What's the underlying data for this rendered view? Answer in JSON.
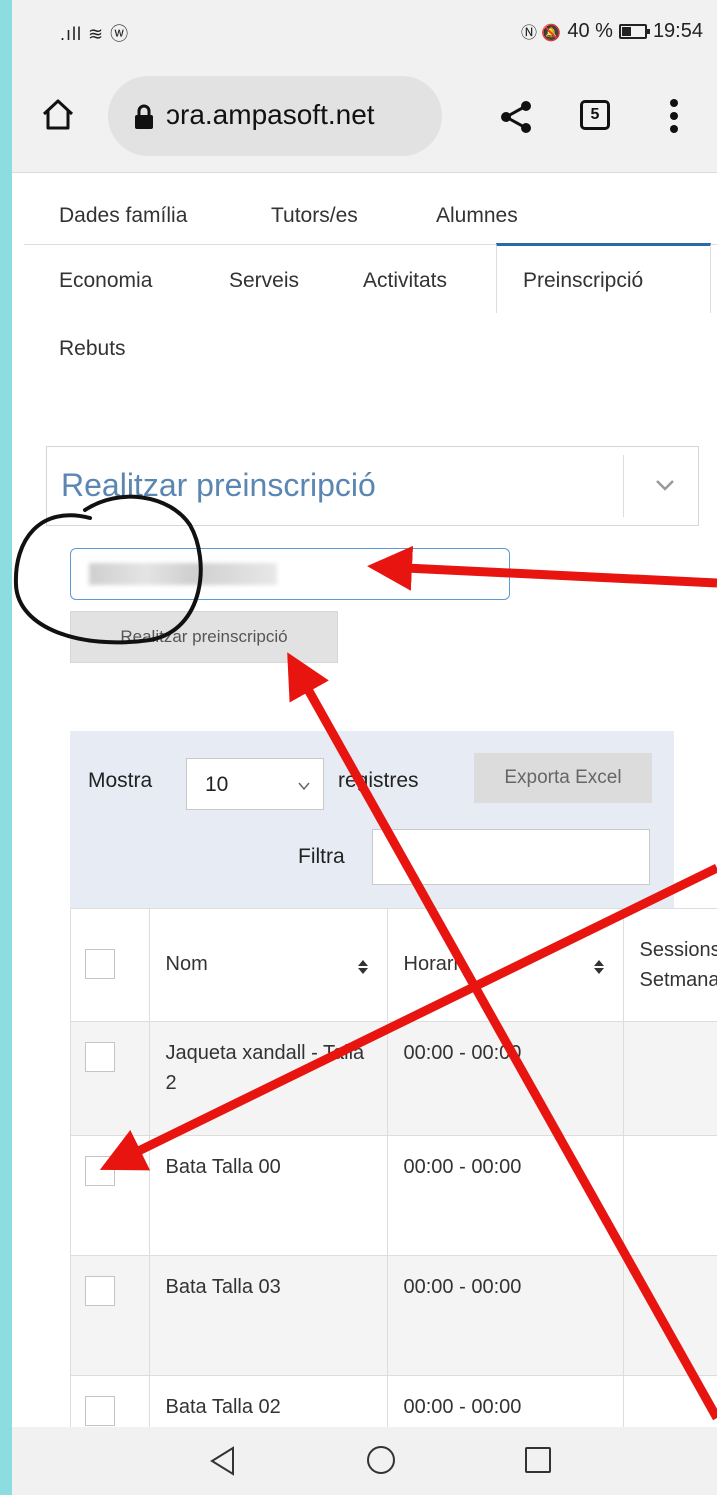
{
  "status_bar": {
    "left_icons": ".ıll ≋ ⓦ",
    "right_icons": "Ⓝ 🔕",
    "battery": "40 %",
    "time": "19:54"
  },
  "browser": {
    "url": "ɔra.ampasoft.net",
    "tab_count": "5"
  },
  "nav": {
    "row1": [
      "Dades família",
      "Tutors/es",
      "Alumnes"
    ],
    "row2": [
      "Economia",
      "Serveis",
      "Activitats",
      "Preinscripció"
    ],
    "row3": [
      "Rebuts"
    ],
    "active": "Preinscripció"
  },
  "panel": {
    "title": "Realitzar preinscripció",
    "button_label": "Realitzar preinscripció"
  },
  "controls": {
    "show_label": "Mostra",
    "length_value": "10",
    "records_label": "registres",
    "export_label": "Exporta Excel",
    "filter_label": "Filtra",
    "filter_value": ""
  },
  "table": {
    "headers": [
      "Nom",
      "Horari",
      "Sessions",
      "Setmanals"
    ],
    "rows": [
      {
        "nom": "Jaqueta xandall - Talla 2",
        "horari": "00:00 - 00:00"
      },
      {
        "nom": "Bata Talla 00",
        "horari": "00:00 - 00:00"
      },
      {
        "nom": "Bata Talla 03",
        "horari": "00:00 - 00:00"
      },
      {
        "nom": "Bata Talla 02",
        "horari": "00:00 - 00:00"
      }
    ]
  },
  "colors": {
    "page_border": "#8cdde0",
    "accent": "#5b86b2",
    "annotation_arrow": "#e8140f",
    "active_tab_border": "#2a6aa7"
  },
  "icons": [
    "home-icon",
    "lock-icon",
    "share-icon",
    "tabs-icon",
    "menu-icon",
    "chevron-down-icon",
    "sort-icon",
    "back-icon",
    "home-circle-icon",
    "recents-icon"
  ]
}
